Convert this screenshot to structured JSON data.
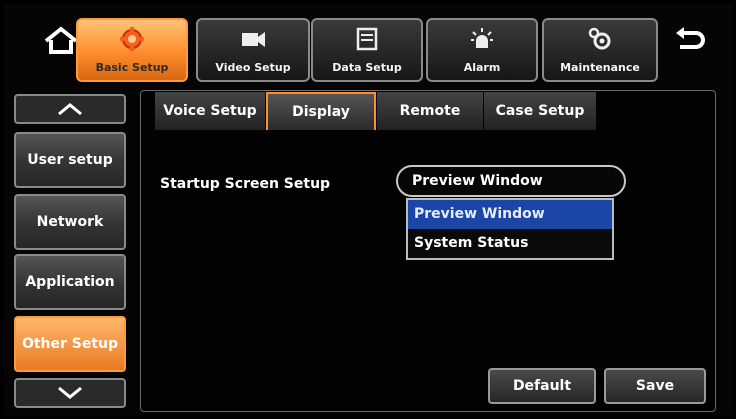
{
  "toolbar": {
    "tabs": [
      {
        "label": "Basic Setup",
        "icon": "gear-icon"
      },
      {
        "label": "Video Setup",
        "icon": "video-camera-icon"
      },
      {
        "label": "Data Setup",
        "icon": "storage-icon"
      },
      {
        "label": "Alarm",
        "icon": "alarm-icon"
      },
      {
        "label": "Maintenance",
        "icon": "maintenance-gears-icon"
      }
    ],
    "active_color": "#ff8d2d"
  },
  "sidebar": {
    "items": [
      {
        "label": "User setup"
      },
      {
        "label": "Network"
      },
      {
        "label": "Application"
      },
      {
        "label": "Other Setup"
      }
    ]
  },
  "subtabs": [
    "Voice Setup",
    "Display",
    "Remote",
    "Case Setup"
  ],
  "main": {
    "startup_label": "Startup Screen Setup",
    "startup_value": "Preview Window",
    "options": [
      "Preview Window",
      "System Status"
    ],
    "highlight_color": "#1b46a8"
  },
  "footer": {
    "default_label": "Default",
    "save_label": "Save"
  }
}
